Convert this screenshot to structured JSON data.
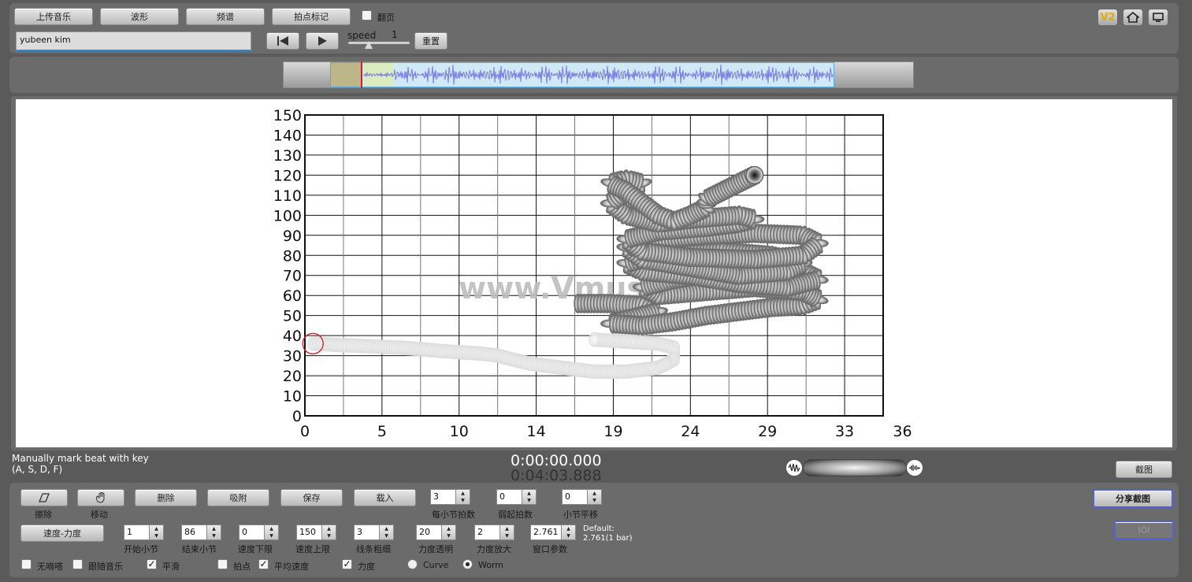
{
  "top": {
    "buttons": [
      "上传音乐",
      "波形",
      "频谱",
      "拍点标记"
    ],
    "flip_page_label": "翻页",
    "flip_page_checked": false,
    "name_input_value": "yubeen kim",
    "speed_label": "speed",
    "speed_value": "1",
    "reset_label": "重置",
    "v2_label": "V2"
  },
  "chart_data": {
    "type": "scatter",
    "xlabel": "",
    "ylabel": "",
    "x_ticks": [
      "0",
      "5",
      "10",
      "14",
      "19",
      "24",
      "29",
      "33",
      "36"
    ],
    "y_ticks": [
      "150",
      "140",
      "130",
      "120",
      "110",
      "100",
      "90",
      "80",
      "70",
      "60",
      "50",
      "40",
      "30",
      "20",
      "10",
      "0"
    ],
    "xlim": [
      0,
      36
    ],
    "ylim": [
      0,
      150
    ],
    "grid": true,
    "watermark": "www.Vmus",
    "cursor_point": {
      "x": 0.5,
      "y": 36
    },
    "head_point": {
      "x": 28,
      "y": 120
    },
    "worm_light": [
      [
        0.5,
        36
      ],
      [
        3,
        35
      ],
      [
        6,
        34
      ],
      [
        9,
        32
      ],
      [
        11,
        31
      ],
      [
        12,
        30
      ],
      [
        13,
        28
      ],
      [
        14,
        26
      ],
      [
        16,
        24
      ],
      [
        18,
        22
      ],
      [
        20,
        22
      ],
      [
        22,
        24
      ],
      [
        23,
        28
      ],
      [
        23,
        34
      ],
      [
        22,
        36
      ],
      [
        20,
        37
      ],
      [
        18,
        38
      ]
    ],
    "worm_dark": [
      [
        17,
        56
      ],
      [
        19,
        56
      ],
      [
        21,
        55
      ],
      [
        22,
        52
      ],
      [
        20,
        48
      ],
      [
        19,
        46
      ],
      [
        21,
        45
      ],
      [
        23,
        47
      ],
      [
        25,
        50
      ],
      [
        27,
        52
      ],
      [
        29,
        54
      ],
      [
        31,
        55
      ],
      [
        32,
        58
      ],
      [
        31,
        62
      ],
      [
        28,
        64
      ],
      [
        25,
        62
      ],
      [
        22,
        60
      ],
      [
        21,
        64
      ],
      [
        23,
        68
      ],
      [
        26,
        72
      ],
      [
        29,
        74
      ],
      [
        31,
        72
      ],
      [
        32,
        68
      ],
      [
        30,
        64
      ],
      [
        27,
        66
      ],
      [
        24,
        70
      ],
      [
        21,
        72
      ],
      [
        20,
        76
      ],
      [
        22,
        80
      ],
      [
        26,
        82
      ],
      [
        29,
        80
      ],
      [
        31,
        76
      ],
      [
        30,
        72
      ],
      [
        27,
        70
      ],
      [
        24,
        74
      ],
      [
        21,
        78
      ],
      [
        20,
        84
      ],
      [
        22,
        88
      ],
      [
        25,
        90
      ],
      [
        28,
        91
      ],
      [
        31,
        90
      ],
      [
        32,
        86
      ],
      [
        31,
        80
      ],
      [
        28,
        78
      ],
      [
        24,
        79
      ],
      [
        21,
        82
      ],
      [
        20,
        88
      ],
      [
        22,
        92
      ],
      [
        25,
        94
      ],
      [
        27,
        96
      ],
      [
        28,
        98
      ],
      [
        27,
        100
      ],
      [
        24,
        98
      ],
      [
        22,
        96
      ],
      [
        20,
        100
      ],
      [
        19,
        106
      ],
      [
        20,
        112
      ],
      [
        21,
        116
      ],
      [
        20,
        118
      ],
      [
        19,
        116
      ],
      [
        20,
        112
      ],
      [
        21,
        106
      ],
      [
        22,
        100
      ],
      [
        23,
        97
      ],
      [
        24,
        100
      ],
      [
        25,
        104
      ],
      [
        25,
        108
      ],
      [
        26,
        112
      ],
      [
        27,
        116
      ],
      [
        28,
        120
      ]
    ]
  },
  "transport": {
    "hint_line1": "Manually mark beat with key",
    "hint_line2": "(A, S, D, F)",
    "time_current": "0:00:00.000",
    "time_total": "0:04:03.888",
    "screenshot_label": "截图"
  },
  "controls": {
    "tool_buttons": [
      {
        "label": "擦除",
        "icon": "eraser-icon"
      },
      {
        "label": "移动",
        "icon": "hand-icon"
      }
    ],
    "action_buttons": [
      "删除",
      "吸附",
      "保存",
      "载入"
    ],
    "spinners_row1": [
      {
        "value": "3",
        "label": "每小节拍数"
      },
      {
        "value": "0",
        "label": "弱起拍数"
      },
      {
        "value": "0",
        "label": "小节平移"
      }
    ],
    "mode_button": "速度-力度",
    "spinners_row2": [
      {
        "value": "1",
        "label": "开始小节"
      },
      {
        "value": "86",
        "label": "结束小节"
      },
      {
        "value": "0",
        "label": "速度下限"
      },
      {
        "value": "150",
        "label": "速度上限"
      },
      {
        "value": "3",
        "label": "线条粗细"
      },
      {
        "value": "20",
        "label": "力度透明"
      },
      {
        "value": "2",
        "label": "力度放大"
      },
      {
        "value": "2.761",
        "label": "窗口参数"
      }
    ],
    "default_line1": "Default:",
    "default_line2": "2.761(1 bar)",
    "share_button": "分享截图",
    "disabled_button": "IOI",
    "checks": [
      {
        "label": "无嘀嗒",
        "checked": false
      },
      {
        "label": "跟随音乐",
        "checked": false
      },
      {
        "label": "平滑",
        "checked": true
      },
      {
        "label": "拍点",
        "checked": false
      },
      {
        "label": "平均速度",
        "checked": true
      },
      {
        "label": "力度",
        "checked": true
      }
    ],
    "radios": [
      {
        "label": "Curve",
        "selected": false
      },
      {
        "label": "Worm",
        "selected": true
      }
    ]
  }
}
